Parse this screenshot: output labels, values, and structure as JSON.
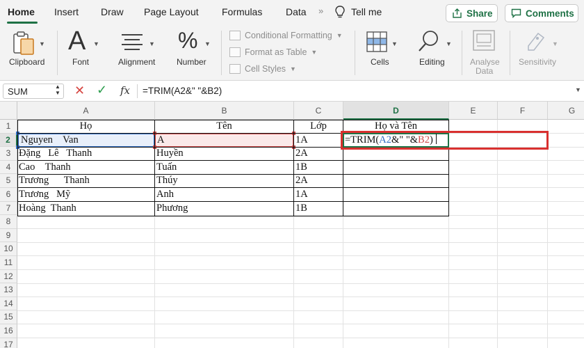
{
  "tabs": {
    "home": "Home",
    "insert": "Insert",
    "draw": "Draw",
    "page_layout": "Page Layout",
    "formulas": "Formulas",
    "data": "Data",
    "more": "»",
    "tell_me": "Tell me"
  },
  "header_buttons": {
    "share": "Share",
    "comments": "Comments"
  },
  "ribbon": {
    "clipboard": "Clipboard",
    "font": "Font",
    "alignment": "Alignment",
    "number": "Number",
    "conditional_formatting": "Conditional Formatting",
    "format_as_table": "Format as Table",
    "cell_styles": "Cell Styles",
    "cells": "Cells",
    "editing": "Editing",
    "analyse_data_line1": "Analyse",
    "analyse_data_line2": "Data",
    "sensitivity": "Sensitivity"
  },
  "formula_bar": {
    "name_box": "SUM",
    "fx": "fx",
    "formula": "=TRIM(A2&\" \"&B2)"
  },
  "grid": {
    "columns": [
      "A",
      "B",
      "C",
      "D",
      "E",
      "F",
      "G"
    ],
    "rows": [
      "1",
      "2",
      "3",
      "4",
      "5",
      "6",
      "7",
      "8",
      "9",
      "10",
      "11",
      "12",
      "13",
      "14",
      "15",
      "16",
      "17"
    ],
    "selected_column": "D",
    "selected_row": "2",
    "header_row": [
      "Họ",
      "Tên",
      "Lớp",
      "Họ và Tên"
    ],
    "data_rows": [
      [
        "Nguyen    Van",
        "A",
        "1A"
      ],
      [
        "Đặng   Lê   Thanh",
        "Huyền",
        "2A"
      ],
      [
        "Cao    Thanh",
        "Tuấn",
        "1B"
      ],
      [
        "Trương      Thanh",
        "Thúy",
        "2A"
      ],
      [
        "Trương   Mỹ",
        "Anh",
        "1A"
      ],
      [
        "Hoàng  Thanh",
        "Phương",
        "1B"
      ]
    ],
    "editing_cell": {
      "prefix": "=TRIM(",
      "ref_a": "A2",
      "middle": "&\" \"&",
      "ref_b": "B2",
      "suffix": ")"
    }
  },
  "colors": {
    "accent_green": "#1e7145",
    "ref_blue": "#2f6cc2",
    "ref_red": "#d14b4b",
    "highlight_red": "#d9302f"
  }
}
